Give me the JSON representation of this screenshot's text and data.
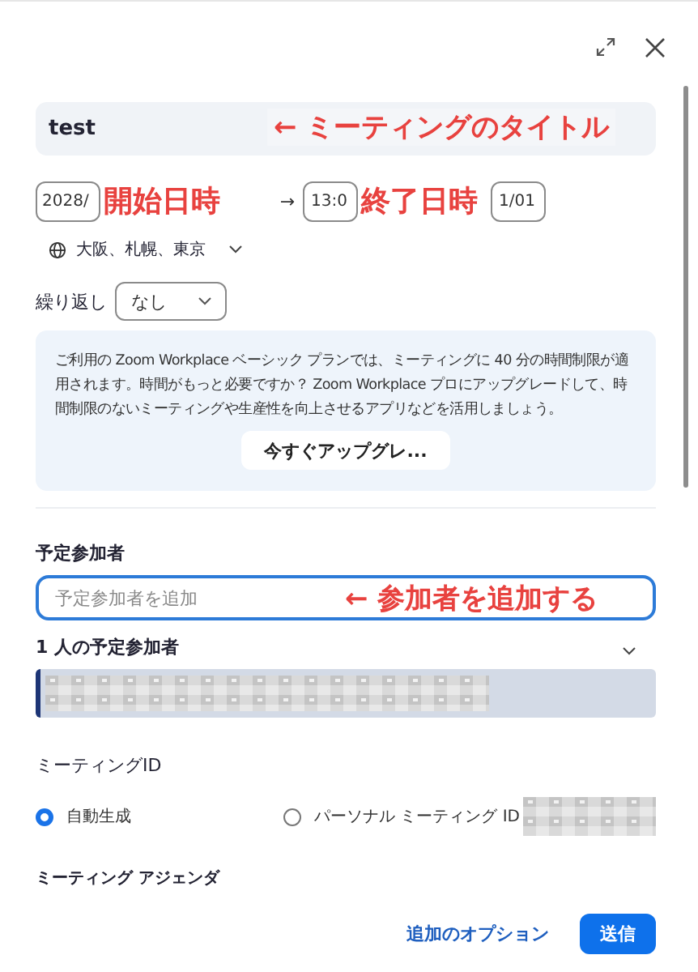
{
  "title_field": {
    "value": "test",
    "annotation": "← ミーティングのタイトル"
  },
  "schedule": {
    "start": {
      "date": "2028/",
      "annotation": "開始日時"
    },
    "arrow": "→",
    "end": {
      "time": "13:0",
      "date": "1/01",
      "annotation": "終了日時"
    },
    "timezone": "大阪、札幌、東京"
  },
  "repeat": {
    "label": "繰り返し",
    "value": "なし"
  },
  "plan_notice": {
    "text": "ご利用の Zoom Workplace ベーシック プランでは、ミーティングに 40 分の時間制限が適用されます。時間がもっと必要ですか？ Zoom Workplace プロにアップグレードして、時間制限のないミーティングや生産性を向上させるアプリなどを活用しましょう。",
    "button": "今すぐアップグレ..."
  },
  "attendees": {
    "label": "予定参加者",
    "placeholder": "予定参加者を追加",
    "annotation": "← 参加者を追加する",
    "count_label": "1 人の予定参加者",
    "expanded": true,
    "items": [
      {
        "kind": "redacted"
      }
    ]
  },
  "meeting_id": {
    "label": "ミーティングID",
    "options": [
      {
        "label": "自動生成",
        "selected": true,
        "redacted": false
      },
      {
        "label": "パーソナル ミーティング ID",
        "selected": false,
        "redacted": true
      }
    ]
  },
  "agenda": {
    "label": "ミーティング アジェンダ"
  },
  "footer": {
    "link": "追加のオプション",
    "button": "送信"
  }
}
